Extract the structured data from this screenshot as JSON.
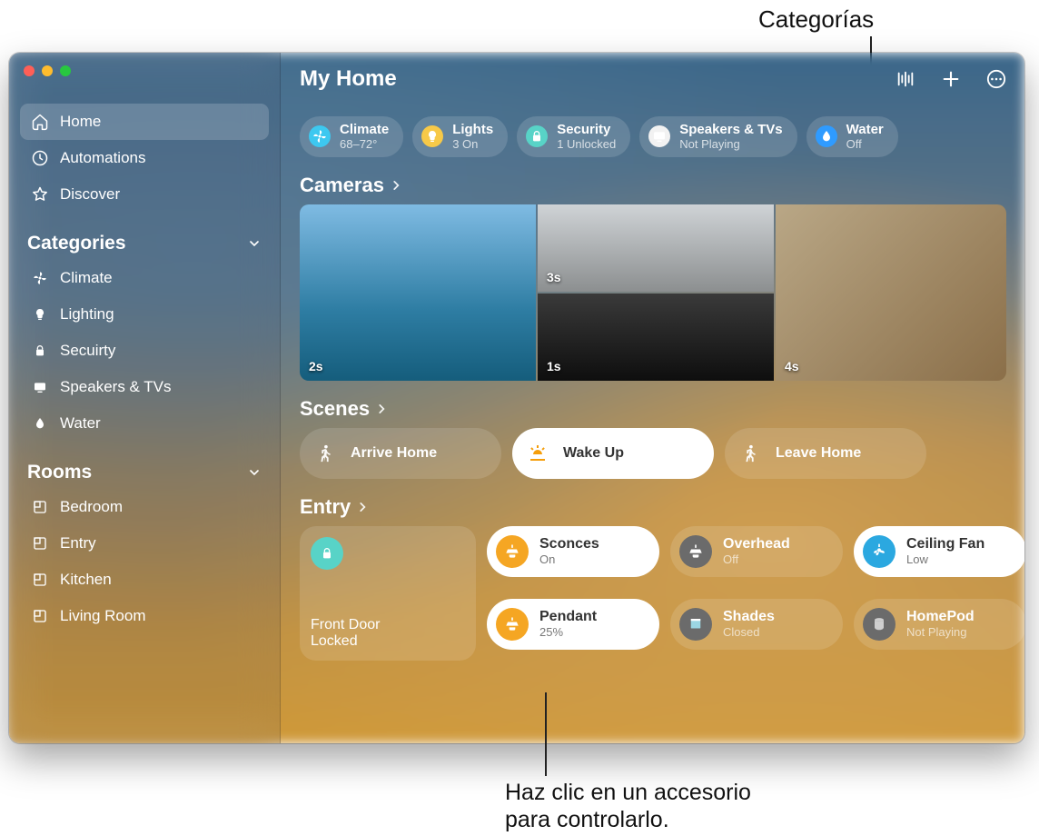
{
  "annotations": {
    "top": "Categorías",
    "bottom_line1": "Haz clic en un accesorio",
    "bottom_line2": "para controlarlo."
  },
  "header": {
    "title": "My Home"
  },
  "sidebar": {
    "primary": [
      {
        "icon": "home",
        "label": "Home",
        "active": true
      },
      {
        "icon": "clock",
        "label": "Automations"
      },
      {
        "icon": "star",
        "label": "Discover"
      }
    ],
    "sections": [
      {
        "title": "Categories",
        "items": [
          {
            "icon": "fan",
            "label": "Climate"
          },
          {
            "icon": "bulb",
            "label": "Lighting"
          },
          {
            "icon": "lock",
            "label": "Secuirty"
          },
          {
            "icon": "tv",
            "label": "Speakers & TVs"
          },
          {
            "icon": "drop",
            "label": "Water"
          }
        ]
      },
      {
        "title": "Rooms",
        "items": [
          {
            "icon": "room",
            "label": "Bedroom"
          },
          {
            "icon": "room",
            "label": "Entry"
          },
          {
            "icon": "room",
            "label": "Kitchen"
          },
          {
            "icon": "room",
            "label": "Living Room"
          }
        ]
      }
    ]
  },
  "pills": [
    {
      "icon": "fan",
      "icon_bg": "#3DC8F0",
      "label": "Climate",
      "sub": "68–72°"
    },
    {
      "icon": "bulb",
      "icon_bg": "#F7C948",
      "label": "Lights",
      "sub": "3 On"
    },
    {
      "icon": "lock",
      "icon_bg": "#58D3C7",
      "label": "Security",
      "sub": "1 Unlocked"
    },
    {
      "icon": "tv",
      "icon_bg": "#F2F2F2",
      "label": "Speakers & TVs",
      "sub": "Not Playing"
    },
    {
      "icon": "drop",
      "icon_bg": "#2F9BFF",
      "label": "Water",
      "sub": "Off"
    }
  ],
  "sections": {
    "cameras": {
      "title": "Cameras",
      "timestamps": [
        "2s",
        "3s",
        "1s",
        "4s"
      ]
    },
    "scenes": {
      "title": "Scenes",
      "items": [
        {
          "icon": "person-walk",
          "label": "Arrive Home",
          "active": false
        },
        {
          "icon": "sunrise",
          "label": "Wake Up",
          "active": true
        },
        {
          "icon": "person-walk",
          "label": "Leave Home",
          "active": false
        }
      ]
    },
    "entry": {
      "title": "Entry",
      "lock": {
        "name": "Front Door",
        "state": "Locked"
      },
      "tiles": [
        {
          "icon": "ceiling-light",
          "icon_bg": "#F5A623",
          "name": "Sconces",
          "state": "On",
          "on": true
        },
        {
          "icon": "ceiling-light",
          "icon_bg": "#6B6B6B",
          "name": "Overhead",
          "state": "Off",
          "on": false
        },
        {
          "icon": "ceiling-fan",
          "icon_bg": "#2BA8E0",
          "name": "Ceiling Fan",
          "state": "Low",
          "on": true
        },
        {
          "icon": "ceiling-light",
          "icon_bg": "#F5A623",
          "name": "Pendant",
          "state": "25%",
          "on": true
        },
        {
          "icon": "shades",
          "icon_bg": "#6B6B6B",
          "name": "Shades",
          "state": "Closed",
          "on": false
        },
        {
          "icon": "homepod",
          "icon_bg": "#6B6B6B",
          "name": "HomePod",
          "state": "Not Playing",
          "on": false
        }
      ]
    }
  }
}
